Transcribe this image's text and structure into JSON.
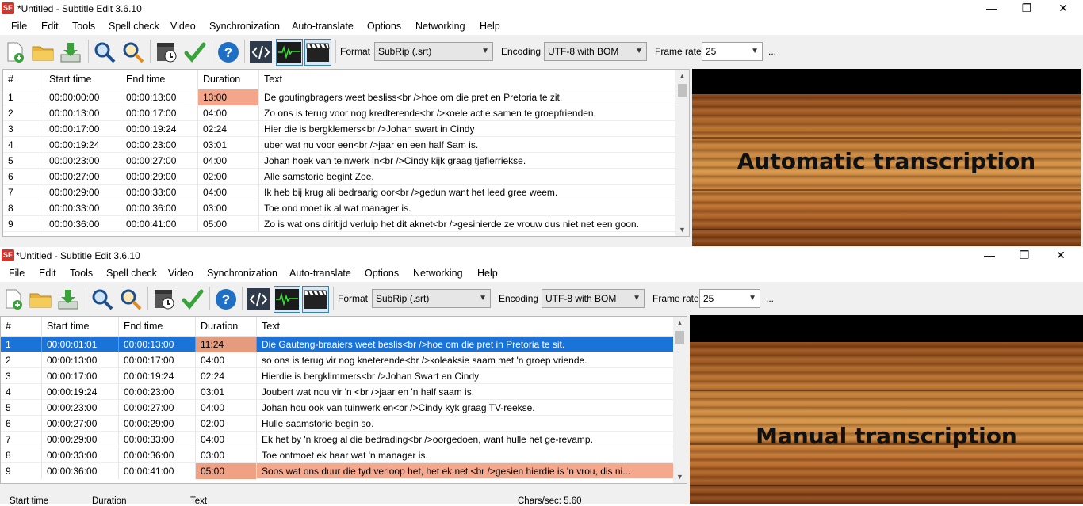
{
  "windows": [
    {
      "title": "*Untitled - Subtitle Edit 3.6.10",
      "app_icon": "SE",
      "controls": {
        "minimize": "—",
        "maximize": "❐",
        "close": "✕"
      },
      "menu": [
        "File",
        "Edit",
        "Tools",
        "Spell check",
        "Video",
        "Synchronization",
        "Auto-translate",
        "Options",
        "Networking",
        "Help"
      ],
      "toolbar": {
        "format_label": "Format",
        "format_value": "SubRip (.srt)",
        "encoding_label": "Encoding",
        "encoding_value": "UTF-8 with BOM",
        "framerate_label": "Frame rate",
        "framerate_value": "25",
        "more": "..."
      },
      "columns": [
        "#",
        "Start time",
        "End time",
        "Duration",
        "Text"
      ],
      "rows": [
        {
          "n": "1",
          "start": "00:00:00:00",
          "end": "00:00:13:00",
          "dur": "13:00",
          "text": "De goutingbragers weet besliss<br />hoe om die pret en Pretoria te zit.",
          "warn": true
        },
        {
          "n": "2",
          "start": "00:00:13:00",
          "end": "00:00:17:00",
          "dur": "04:00",
          "text": "Zo ons is terug voor nog kredterende<br />koele actie samen te groepfrienden."
        },
        {
          "n": "3",
          "start": "00:00:17:00",
          "end": "00:00:19:24",
          "dur": "02:24",
          "text": "Hier die is bergklemers<br />Johan swart in Cindy"
        },
        {
          "n": "4",
          "start": "00:00:19:24",
          "end": "00:00:23:00",
          "dur": "03:01",
          "text": "uber wat nu voor een<br />jaar en een half Sam is."
        },
        {
          "n": "5",
          "start": "00:00:23:00",
          "end": "00:00:27:00",
          "dur": "04:00",
          "text": "Johan hoek van teinwerk in<br />Cindy kijk graag tjefierriekse."
        },
        {
          "n": "6",
          "start": "00:00:27:00",
          "end": "00:00:29:00",
          "dur": "02:00",
          "text": "Alle samstorie begint Zoe."
        },
        {
          "n": "7",
          "start": "00:00:29:00",
          "end": "00:00:33:00",
          "dur": "04:00",
          "text": "Ik heb bij krug ali bedraarig oor<br />gedun want het leed gree weem."
        },
        {
          "n": "8",
          "start": "00:00:33:00",
          "end": "00:00:36:00",
          "dur": "03:00",
          "text": "Toe ond moet ik al wat manager is."
        },
        {
          "n": "9",
          "start": "00:00:36:00",
          "end": "00:00:41:00",
          "dur": "05:00",
          "text": "Zo is wat ons diritijd verluip het dit aknet<br />gesinierde ze vrouw dus niet net een goon."
        }
      ],
      "video_caption": "Automatic transcription"
    },
    {
      "title": "*Untitled - Subtitle Edit 3.6.10",
      "app_icon": "SE",
      "controls": {
        "minimize": "—",
        "maximize": "❐",
        "close": "✕"
      },
      "menu": [
        "File",
        "Edit",
        "Tools",
        "Spell check",
        "Video",
        "Synchronization",
        "Auto-translate",
        "Options",
        "Networking",
        "Help"
      ],
      "toolbar": {
        "format_label": "Format",
        "format_value": "SubRip (.srt)",
        "encoding_label": "Encoding",
        "encoding_value": "UTF-8 with BOM",
        "framerate_label": "Frame rate",
        "framerate_value": "25",
        "more": "..."
      },
      "columns": [
        "#",
        "Start time",
        "End time",
        "Duration",
        "Text"
      ],
      "rows": [
        {
          "n": "1",
          "start": "00:00:01:01",
          "end": "00:00:13:00",
          "dur": "11:24",
          "text": "Die Gauteng-braaiers weet beslis<br />hoe om die pret in Pretoria te sit.",
          "warn": true,
          "selected": true
        },
        {
          "n": "2",
          "start": "00:00:13:00",
          "end": "00:00:17:00",
          "dur": "04:00",
          "text": "so ons is terug vir nog kneterende<br />koleaksie saam met 'n groep vriende."
        },
        {
          "n": "3",
          "start": "00:00:17:00",
          "end": "00:00:19:24",
          "dur": "02:24",
          "text": "Hierdie is bergklimmers<br />Johan Swart en Cindy"
        },
        {
          "n": "4",
          "start": "00:00:19:24",
          "end": "00:00:23:00",
          "dur": "03:01",
          "text": "Joubert wat nou vir 'n <br />jaar en 'n half saam is."
        },
        {
          "n": "5",
          "start": "00:00:23:00",
          "end": "00:00:27:00",
          "dur": "04:00",
          "text": "Johan hou ook van tuinwerk en<br />Cindy kyk graag TV-reekse."
        },
        {
          "n": "6",
          "start": "00:00:27:00",
          "end": "00:00:29:00",
          "dur": "02:00",
          "text": "Hulle saamstorie begin so."
        },
        {
          "n": "7",
          "start": "00:00:29:00",
          "end": "00:00:33:00",
          "dur": "04:00",
          "text": "Ek het by 'n kroeg al die bedrading<br />oorgedoen, want hulle het ge-revamp."
        },
        {
          "n": "8",
          "start": "00:00:33:00",
          "end": "00:00:36:00",
          "dur": "03:00",
          "text": "Toe ontmoet ek haar wat 'n manager is."
        },
        {
          "n": "9",
          "start": "00:00:36:00",
          "end": "00:00:41:00",
          "dur": "05:00",
          "text": "Soos wat ons duur die tyd verloop het, het ek net <br />gesien hierdie is 'n vrou, dis ni...",
          "warn": true,
          "red": true
        }
      ],
      "video_caption": "Manual transcription",
      "bottom_panel": {
        "start_label": "Start time",
        "duration_label": "Duration",
        "text_label": "Text",
        "chars_sec": "Chars/sec: 5.60"
      }
    }
  ],
  "icons": [
    "new-file-icon",
    "open-folder-icon",
    "download-icon",
    "find-icon",
    "replace-icon",
    "visual-sync-icon",
    "spell-check-icon",
    "help-icon",
    "source-view-icon",
    "waveform-icon",
    "video-icon"
  ],
  "colors": {
    "selection": "#1a73d9",
    "warning": "#f4a58a",
    "accent": "#3c7fb1"
  }
}
